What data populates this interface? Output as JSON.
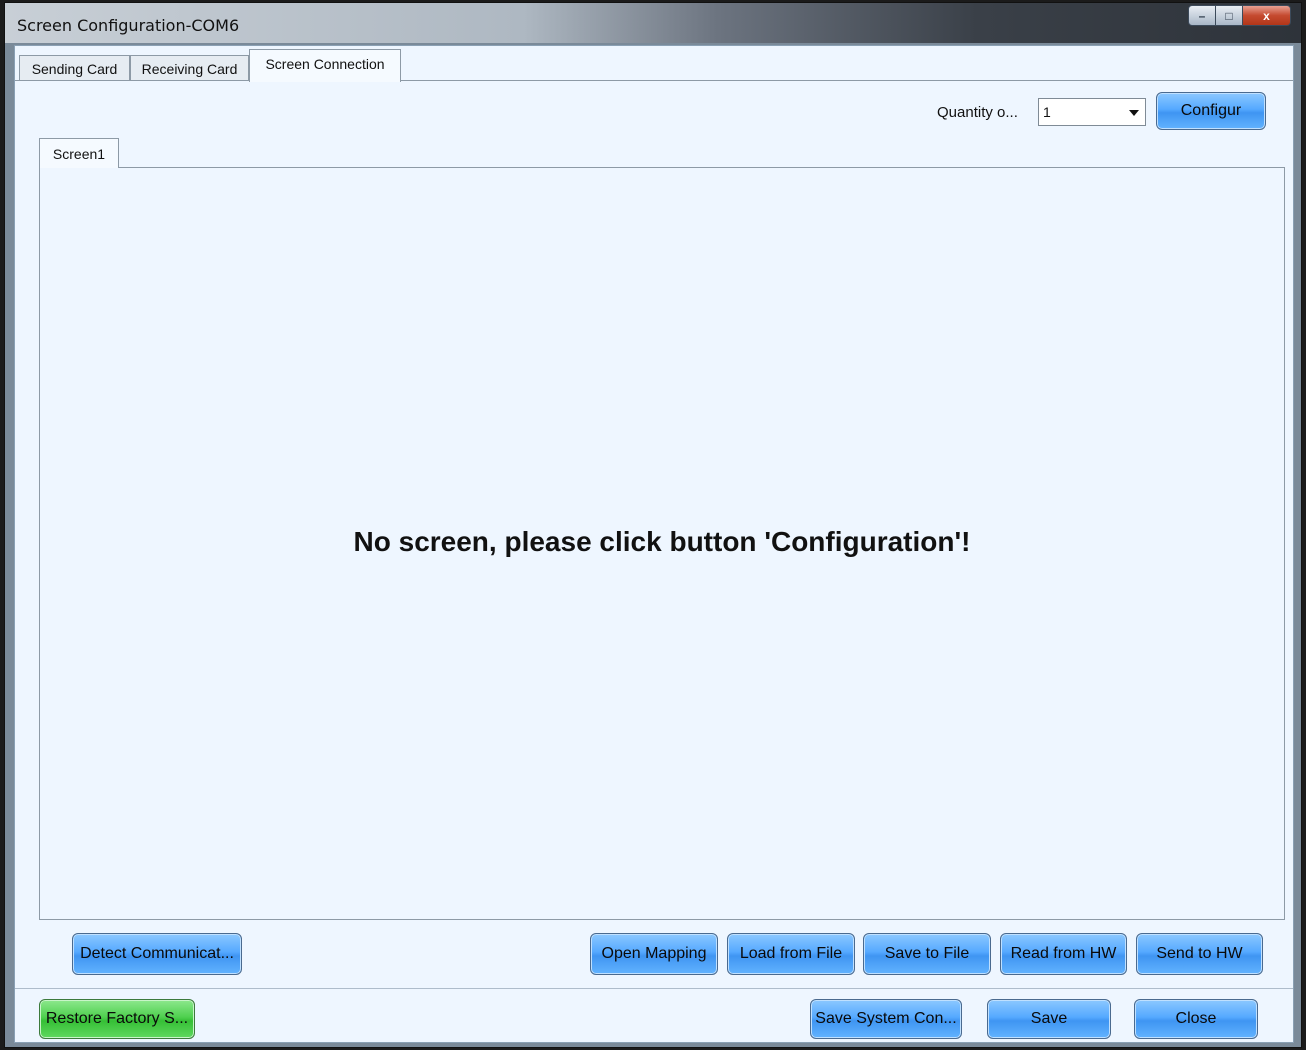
{
  "window": {
    "title": "Screen Configuration-COM6",
    "controls": {
      "minimize": "–",
      "maximize": "□",
      "close": "x"
    }
  },
  "tabs": [
    {
      "label": "Sending Card",
      "active": false
    },
    {
      "label": "Receiving Card",
      "active": false
    },
    {
      "label": "Screen Connection",
      "active": true
    }
  ],
  "quantity": {
    "label": "Quantity o...",
    "value": "1"
  },
  "configure_button": "Configur",
  "screen_tabs": [
    {
      "label": "Screen1",
      "active": true
    }
  ],
  "empty_message": "No screen, please click button 'Configuration'!",
  "actions": {
    "detect": "Detect Communicat...",
    "open_mapping": "Open Mapping",
    "load_from_file": "Load from File",
    "save_to_file": "Save to File",
    "read_from_hw": "Read from HW",
    "send_to_hw": "Send to HW"
  },
  "footer": {
    "restore": "Restore Factory S...",
    "save_system": "Save System Con...",
    "save": "Save",
    "close": "Close"
  },
  "colors": {
    "button_blue": "#55a9ff",
    "button_green": "#4fd04f",
    "client_bg": "#eef6ff"
  }
}
